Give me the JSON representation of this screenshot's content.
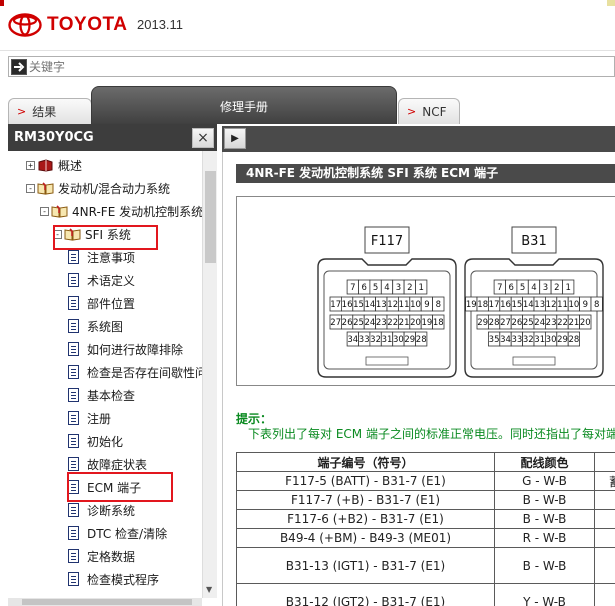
{
  "header": {
    "brand": "TOYOTA",
    "pub_date": "2013.11"
  },
  "search": {
    "placeholder": "关键字",
    "value": ""
  },
  "tabs": [
    {
      "label": "结果",
      "active": false
    },
    {
      "label": "修理手册",
      "active": true
    },
    {
      "label": "NCF",
      "active": false
    }
  ],
  "left_panel": {
    "doc_id": "RM30Y0CG",
    "close_label": "×"
  },
  "tree": {
    "items": [
      {
        "label": "概述",
        "level": 0,
        "toggle": "+",
        "icon": "red-book-icon"
      },
      {
        "label": "发动机/混合动力系统",
        "level": 0,
        "toggle": "−",
        "icon": "open-book-icon"
      },
      {
        "label": "4NR-FE 发动机控制系统",
        "level": 1,
        "toggle": "−",
        "icon": "open-book-icon"
      },
      {
        "label": "SFI 系统",
        "level": 2,
        "toggle": "−",
        "icon": "open-book-icon",
        "highlighted": true
      },
      {
        "label": "注意事项",
        "level": 3,
        "icon": "page-icon"
      },
      {
        "label": "术语定义",
        "level": 3,
        "icon": "page-icon"
      },
      {
        "label": "部件位置",
        "level": 3,
        "icon": "page-icon"
      },
      {
        "label": "系统图",
        "level": 3,
        "icon": "page-icon"
      },
      {
        "label": "如何进行故障排除",
        "level": 3,
        "icon": "page-icon"
      },
      {
        "label": "检查是否存在间歇性问",
        "level": 3,
        "icon": "page-icon"
      },
      {
        "label": "基本检查",
        "level": 3,
        "icon": "page-icon"
      },
      {
        "label": "注册",
        "level": 3,
        "icon": "page-icon"
      },
      {
        "label": "初始化",
        "level": 3,
        "icon": "page-icon"
      },
      {
        "label": "故障症状表",
        "level": 3,
        "icon": "page-icon"
      },
      {
        "label": "ECM 端子",
        "level": 3,
        "icon": "page-icon",
        "highlighted": true
      },
      {
        "label": "诊断系统",
        "level": 3,
        "icon": "page-icon"
      },
      {
        "label": "DTC 检查/清除",
        "level": 3,
        "icon": "page-icon"
      },
      {
        "label": "定格数据",
        "level": 3,
        "icon": "page-icon"
      },
      {
        "label": "检查模式程序",
        "level": 3,
        "icon": "page-icon"
      }
    ]
  },
  "content": {
    "title": "4NR-FE 发动机控制系统  SFI 系统  ECM 端子",
    "connectors": {
      "f117": {
        "label": "F117",
        "row1": [
          "7",
          "6",
          "5",
          "4",
          "3",
          "2",
          "1"
        ],
        "row2": [
          "17",
          "16",
          "15",
          "14",
          "13",
          "12",
          "11",
          "10",
          "9",
          "8"
        ],
        "row3": [
          "27",
          "26",
          "25",
          "24",
          "23",
          "22",
          "21",
          "20",
          "19",
          "18"
        ],
        "row4": [
          "34",
          "33",
          "32",
          "31",
          "30",
          "29",
          "28"
        ]
      },
      "b31": {
        "label": "B31",
        "row1": [
          "7",
          "6",
          "5",
          "4",
          "3",
          "2",
          "1"
        ],
        "row2": [
          "19",
          "18",
          "17",
          "16",
          "15",
          "14",
          "13",
          "12",
          "11",
          "10",
          "9",
          "8"
        ],
        "row3": [
          "29",
          "28",
          "27",
          "26",
          "25",
          "24",
          "23",
          "22",
          "21",
          "20"
        ],
        "row4": [
          "35",
          "34",
          "33",
          "32",
          "31",
          "30",
          "29",
          "28"
        ]
      }
    },
    "hint_label": "提示：",
    "hint_text": "下表列出了每对 ECM 端子之间的标准正常电压。同时还指出了每对端",
    "table": {
      "headers": [
        "端子编号（符号）",
        "配线颜色"
      ],
      "rows": [
        {
          "terminal": "F117-5 (BATT) - B31-7 (E1)",
          "wire": "G - W-B",
          "extra": "蓄"
        },
        {
          "terminal": "F117-7 (+B) - B31-7 (E1)",
          "wire": "B - W-B",
          "extra": ""
        },
        {
          "terminal": "F117-6 (+B2) - B31-7 (E1)",
          "wire": "B - W-B",
          "extra": ""
        },
        {
          "terminal": "B49-4 (+BM) - B49-3 (ME01)",
          "wire": "R - W-B",
          "extra": ""
        },
        {
          "terminal": "B31-13 (IGT1) - B31-7 (E1)",
          "wire": "B - W-B",
          "extra": ""
        },
        {
          "terminal": "B31-12 (IGT2) - B31-7 (E1)",
          "wire": "Y - W-B",
          "extra": ""
        }
      ]
    }
  }
}
